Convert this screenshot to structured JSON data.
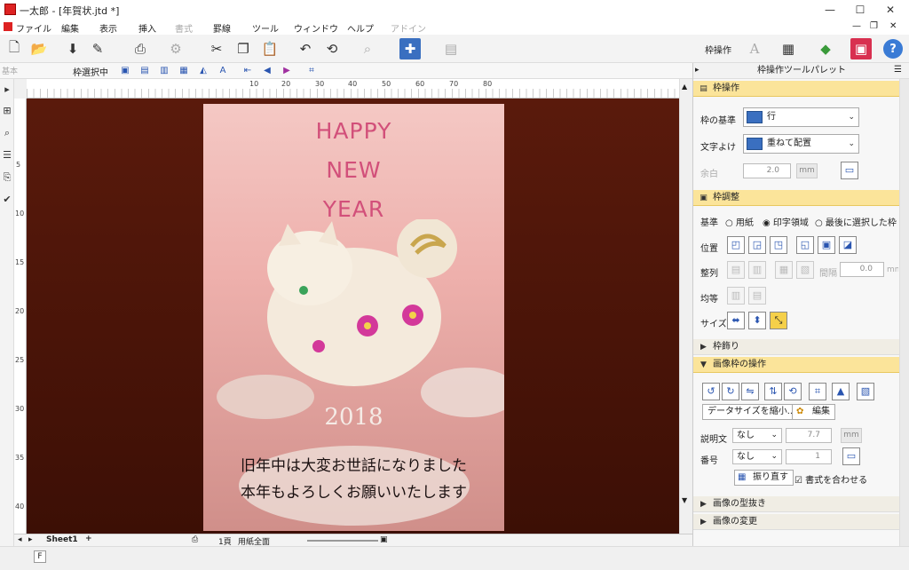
{
  "window": {
    "title": "一太郎 - [年賀状.jtd *]",
    "min": "—",
    "max": "☐",
    "close": "✕"
  },
  "menu": {
    "items": [
      "ファイル",
      "編集",
      "表示",
      "挿入",
      "書式",
      "罫線",
      "ツール",
      "ウィンドウ",
      "ヘルプ",
      "アドイン"
    ],
    "disabled": [
      false,
      false,
      false,
      false,
      true,
      false,
      false,
      false,
      false,
      true
    ],
    "doc_min": "—",
    "doc_restore": "❐",
    "doc_close": "✕"
  },
  "toolbar": {
    "frame_op_label": "枠操作"
  },
  "toolbar2": {
    "style": "基本",
    "frame_select": "枠選択中"
  },
  "ruler": {
    "h_ticks": [
      "10",
      "20",
      "30",
      "40",
      "50",
      "60",
      "70",
      "80"
    ],
    "v_ticks": [
      "5",
      "10",
      "15",
      "20",
      "25",
      "30",
      "35",
      "40"
    ]
  },
  "card": {
    "line1": "HAPPY",
    "line2": "NEW",
    "line3": "YEAR",
    "year": "2018",
    "msg1": "旧年中は大変お世話になりました",
    "msg2": "本年もよろしくお願いいたします"
  },
  "bottom": {
    "sheet": "Sheet1",
    "add": "+",
    "page": "1頁",
    "view": "用紙全面"
  },
  "status": {
    "mode": "F"
  },
  "panel": {
    "title": "枠操作ツールパレット",
    "sec_frame": "枠操作",
    "base_label": "枠の基準",
    "base_value": "行",
    "wrap_label": "文字よけ",
    "wrap_value": "重ねて配置",
    "margin_label": "余白",
    "margin_value": "2.0",
    "margin_unit": "mm",
    "sec_adjust": "枠調整",
    "ref_label": "基準",
    "ref_opt1": "用紙",
    "ref_opt2": "印字領域",
    "ref_opt3": "最後に選択した枠",
    "pos_label": "位置",
    "align_label": "整列",
    "gap_label": "間隔",
    "gap_value": "0.0",
    "gap_unit": "mm",
    "equal_label": "均等",
    "size_label": "サイズ",
    "sec_decor": "枠飾り",
    "sec_image": "画像枠の操作",
    "shrink_btn": "データサイズを縮小...",
    "edit_btn": "編集",
    "caption_label": "説明文",
    "caption_value": "なし",
    "caption_size": "7.7",
    "caption_unit": "mm",
    "number_label": "番号",
    "number_value": "なし",
    "number_size": "1",
    "reflow_btn": "振り直す",
    "match_label": "書式を合わせる",
    "sec_cutout": "画像の型抜き",
    "sec_change": "画像の変更"
  }
}
